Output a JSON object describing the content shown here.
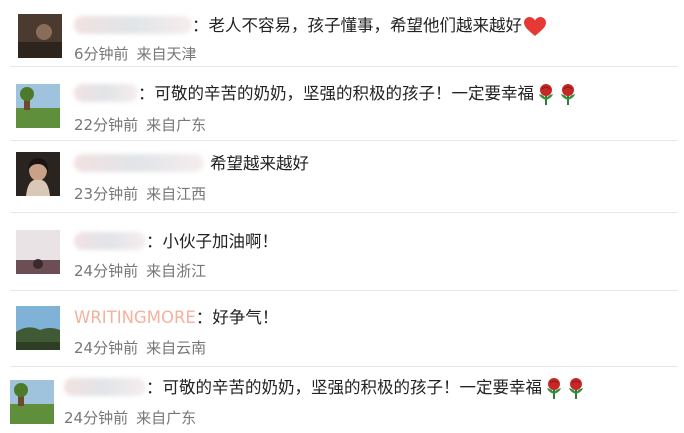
{
  "comments": [
    {
      "username": "",
      "text": "：老人不容易，孩子懂事，希望他们越来越好",
      "emojis": [
        "heart"
      ],
      "time": "6分钟前",
      "location": "来自天津"
    },
    {
      "username": "",
      "text": "：可敬的辛苦的奶奶，坚强的积极的孩子！一定要幸福",
      "emojis": [
        "rose",
        "rose"
      ],
      "time": "22分钟前",
      "location": "来自广东"
    },
    {
      "username": "",
      "text": "希望越来越好",
      "emojis": [],
      "time": "23分钟前",
      "location": "来自江西"
    },
    {
      "username": "",
      "text": "：小伙子加油啊！",
      "emojis": [],
      "time": "24分钟前",
      "location": "来自浙江"
    },
    {
      "username": "WRITINGMORE",
      "text": "：好争气！",
      "emojis": [],
      "time": "24分钟前",
      "location": "来自云南"
    },
    {
      "username": "",
      "text": "：可敬的辛苦的奶奶，坚强的积极的孩子！一定要幸福",
      "emojis": [
        "rose",
        "rose"
      ],
      "time": "24分钟前",
      "location": "来自广东"
    }
  ],
  "icons": {
    "heart": "heart-emoji-icon",
    "rose": "rose-emoji-icon"
  },
  "colors": {
    "username": "#eb7350",
    "text": "#222222",
    "meta": "#777777",
    "divider": "#e6e6e6",
    "heart": "#e53935",
    "rose": "#c62828"
  }
}
